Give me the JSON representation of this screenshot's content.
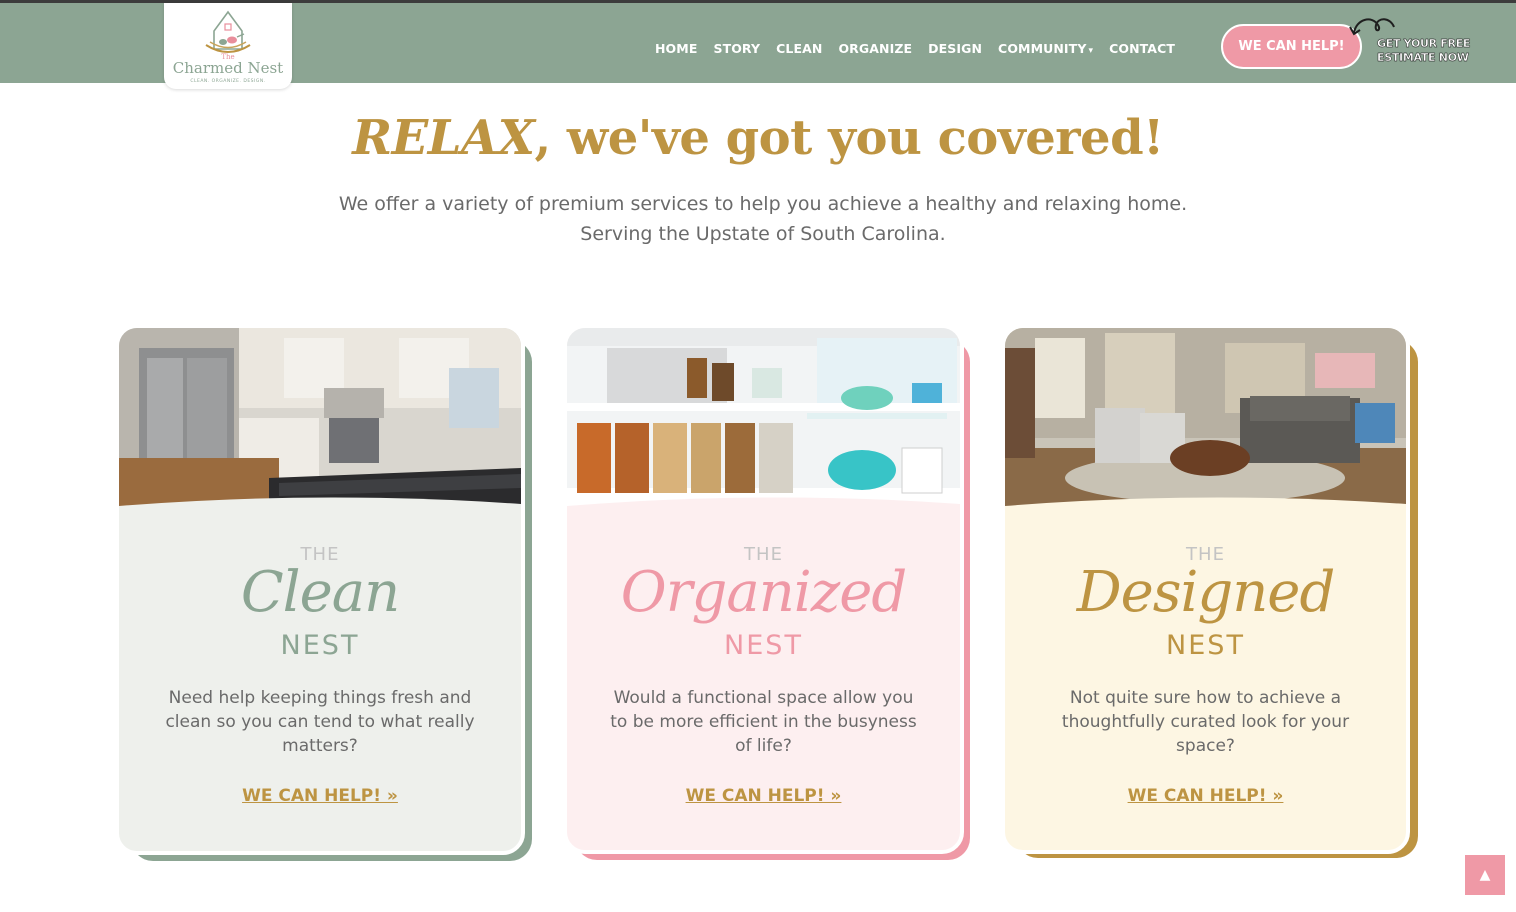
{
  "header": {
    "logo": {
      "small": "The",
      "name": "Charmed Nest",
      "tagline": "CLEAN. ORGANIZE. DESIGN."
    },
    "nav": [
      {
        "label": "HOME"
      },
      {
        "label": "STORY"
      },
      {
        "label": "CLEAN"
      },
      {
        "label": "ORGANIZE"
      },
      {
        "label": "DESIGN"
      },
      {
        "label": "COMMUNITY",
        "has_dropdown": true
      },
      {
        "label": "CONTACT"
      }
    ],
    "cta_label": "WE CAN HELP!",
    "estimate_line1": "GET YOUR FREE",
    "estimate_line2": "ESTIMATE NOW"
  },
  "hero": {
    "title_italic": "RELAX",
    "title_rest": ", we've got you covered!",
    "subtitle_line1": "We offer a variety of premium services to help you achieve a healthy and relaxing home.",
    "subtitle_line2": "Serving the Upstate of South Carolina."
  },
  "cards": [
    {
      "the": "THE",
      "name": "Clean",
      "nest": "NEST",
      "description": "Need help keeping things fresh and clean so you can tend to what really matters?",
      "link": "WE CAN HELP! »",
      "bg": "#eef0ec",
      "accent": "#8ca593",
      "image": "kitchen"
    },
    {
      "the": "THE",
      "name": "Organized",
      "nest": "NEST",
      "description": "Would a functional space allow you to be more efficient in the busyness of life?",
      "link": "WE CAN HELP! »",
      "bg": "#fdeff0",
      "accent": "#ef99a6",
      "image": "pantry"
    },
    {
      "the": "THE",
      "name": "Designed",
      "nest": "NEST",
      "description": "Not quite sure how to achieve a thoughtfully curated look for your space?",
      "link": "WE CAN HELP! »",
      "bg": "#fdf6e3",
      "accent": "#bd9442",
      "image": "living-room"
    }
  ],
  "colors": {
    "header_bg": "#8ca593",
    "gold": "#bd9442",
    "pink": "#ef99a6",
    "sage": "#8ca593"
  },
  "scroll_top_icon": "chevron-up-icon"
}
